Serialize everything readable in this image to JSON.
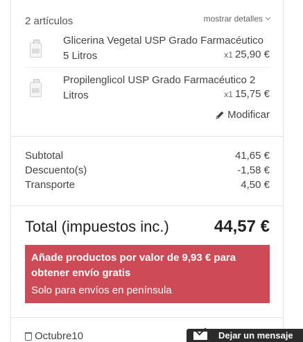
{
  "cart": {
    "count_label": "2 artículos",
    "details_toggle": "mostrar detalles",
    "items": [
      {
        "name": "Glicerina Vegetal USP Grado Farmacéutico 5 Litros",
        "qty": "x1",
        "price": "25,90 €",
        "icon": "product-jug-icon"
      },
      {
        "name": "Propilenglicol USP Grado Farmacéutico 2 Litros",
        "qty": "x1",
        "price": "15,75 €",
        "icon": "product-jug-icon"
      }
    ],
    "modify_label": "Modificar"
  },
  "summary": {
    "subtotal_label": "Subtotal",
    "subtotal_value": "41,65 €",
    "discount_label": "Descuento(s)",
    "discount_value": "-1,58 €",
    "shipping_label": "Transporte",
    "shipping_value": "4,50 €",
    "total_label": "Total (impuestos inc.)",
    "total_value": "44,57 €"
  },
  "alert": {
    "message": "Añade productos por valor de 9,93 € para obtener envío gratis",
    "note": "Solo para envíos en península",
    "color": "#cc4b57"
  },
  "voucher": {
    "code": "Octubre10"
  },
  "chat": {
    "label": "Dejar un mensaje"
  }
}
